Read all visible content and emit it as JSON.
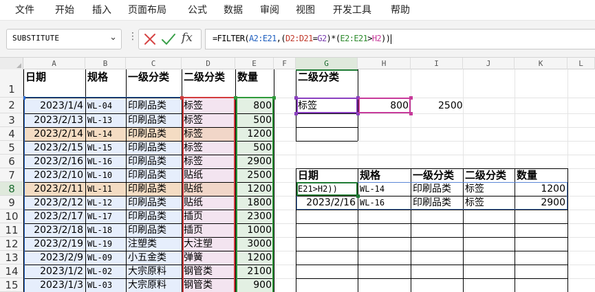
{
  "menu": [
    "文件",
    "开始",
    "插入",
    "页面布局",
    "公式",
    "数据",
    "审阅",
    "视图",
    "开发工具",
    "帮助"
  ],
  "formula_bar": {
    "name_box": "SUBSTITUTE",
    "fx_label": "fx",
    "formula_parts": [
      {
        "text": "=FILTER(",
        "cls": ""
      },
      {
        "text": "A2:E21",
        "cls": "fr-a"
      },
      {
        "text": ",(",
        "cls": ""
      },
      {
        "text": "D2:D21",
        "cls": "fr-d"
      },
      {
        "text": "=",
        "cls": ""
      },
      {
        "text": "G2",
        "cls": "fr-g"
      },
      {
        "text": ")*(",
        "cls": ""
      },
      {
        "text": "E2:E21",
        "cls": "fr-e"
      },
      {
        "text": ">",
        "cls": ""
      },
      {
        "text": "H2",
        "cls": "fr-h"
      },
      {
        "text": "))",
        "cls": ""
      }
    ]
  },
  "columns": [
    "A",
    "B",
    "C",
    "D",
    "E",
    "F",
    "G",
    "H",
    "I",
    "J",
    "K",
    "L"
  ],
  "rows": [
    "1",
    "2",
    "3",
    "4",
    "5",
    "6",
    "7",
    "8",
    "9",
    "10",
    "11",
    "12",
    "13",
    "14",
    "15"
  ],
  "source_table": {
    "headers": [
      "日期",
      "规格",
      "一级分类",
      "二级分类",
      "数量"
    ],
    "rows": [
      [
        "2023/1/4",
        "WL-04",
        "印刷品类",
        "标签",
        "800"
      ],
      [
        "2023/2/13",
        "WL-13",
        "印刷品类",
        "标签",
        "500"
      ],
      [
        "2023/2/14",
        "WL-14",
        "印刷品类",
        "标签",
        "1200"
      ],
      [
        "2023/2/15",
        "WL-15",
        "印刷品类",
        "标签",
        "500"
      ],
      [
        "2023/2/16",
        "WL-16",
        "印刷品类",
        "标签",
        "2900"
      ],
      [
        "2023/2/10",
        "WL-10",
        "印刷品类",
        "贴纸",
        "2500"
      ],
      [
        "2023/2/11",
        "WL-11",
        "印刷品类",
        "贴纸",
        "1200"
      ],
      [
        "2023/2/12",
        "WL-12",
        "印刷品类",
        "贴纸",
        "1800"
      ],
      [
        "2023/2/17",
        "WL-17",
        "印刷品类",
        "插页",
        "2300"
      ],
      [
        "2023/2/18",
        "WL-18",
        "印刷品类",
        "插页",
        "1000"
      ],
      [
        "2023/2/19",
        "WL-19",
        "注塑类",
        "大注塑",
        "3000"
      ],
      [
        "2023/2/9",
        "WL-09",
        "小五金类",
        "弹簧",
        "1200"
      ],
      [
        "2023/1/2",
        "WL-02",
        "大宗原料",
        "钢管类",
        "2100"
      ],
      [
        "2023/1/3",
        "WL-03",
        "大宗原料",
        "钢管类",
        "900"
      ]
    ]
  },
  "criteria": {
    "header": "二级分类",
    "category": "标签",
    "threshold": "800",
    "extra_value": "2500"
  },
  "result_table": {
    "headers": [
      "日期",
      "规格",
      "一级分类",
      "二级分类",
      "数量"
    ],
    "editing_text": "E21>H2))",
    "rows": [
      [
        "",
        "WL-14",
        "印刷品类",
        "标签",
        "1200"
      ],
      [
        "2023/2/16",
        "WL-16",
        "印刷品类",
        "标签",
        "2900"
      ]
    ]
  },
  "colors": {
    "range_a": "#2f6fd6",
    "range_d": "#d23b3b",
    "range_g": "#8a3fc0",
    "range_e": "#2e9a3a",
    "range_h": "#c7399a",
    "highlight_peach": "#f4dcc3",
    "tint_a": "#e6eefc",
    "tint_d": "#f3e4f0",
    "tint_e": "#e3f0e3",
    "active": "#1e7b34"
  }
}
